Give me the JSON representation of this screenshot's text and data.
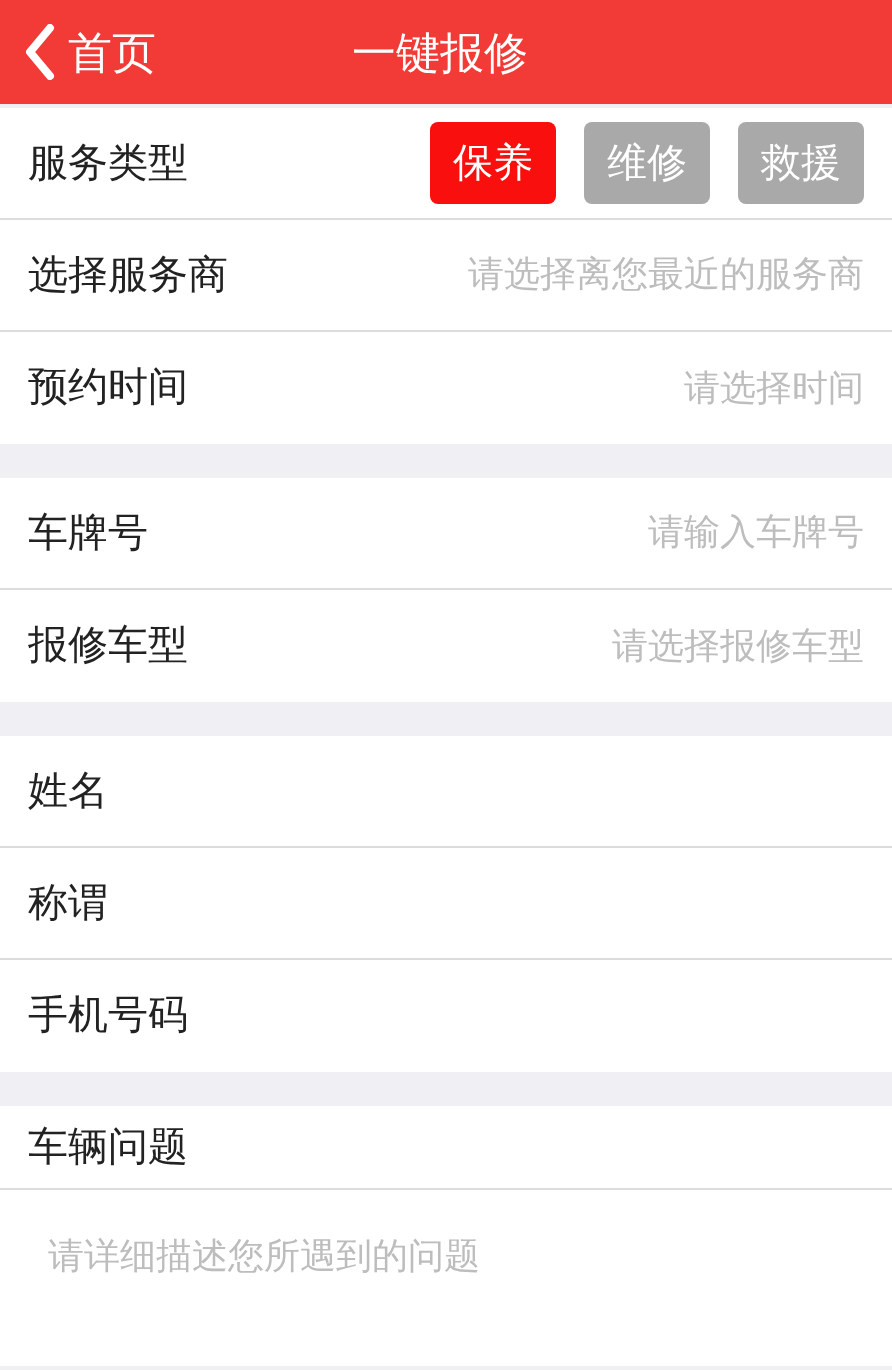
{
  "header": {
    "back_label": "首页",
    "title": "一键报修"
  },
  "sections": [
    {
      "rows": [
        {
          "kind": "options",
          "label": "服务类型",
          "options": [
            {
              "label": "保养",
              "selected": true
            },
            {
              "label": "维修",
              "selected": false
            },
            {
              "label": "救援",
              "selected": false
            }
          ]
        },
        {
          "kind": "field",
          "label": "选择服务商",
          "placeholder": "请选择离您最近的服务商"
        },
        {
          "kind": "field",
          "label": "预约时间",
          "placeholder": "请选择时间"
        }
      ]
    },
    {
      "rows": [
        {
          "kind": "field",
          "label": "车牌号",
          "placeholder": "请输入车牌号"
        },
        {
          "kind": "field",
          "label": "报修车型",
          "placeholder": "请选择报修车型"
        }
      ]
    },
    {
      "rows": [
        {
          "kind": "field",
          "label": "姓名"
        },
        {
          "kind": "field",
          "label": "称谓"
        },
        {
          "kind": "field",
          "label": "手机号码"
        }
      ]
    },
    {
      "rows": [
        {
          "kind": "textarea",
          "label": "车辆问题",
          "placeholder": "请详细描述您所遇到的问题"
        }
      ]
    }
  ]
}
